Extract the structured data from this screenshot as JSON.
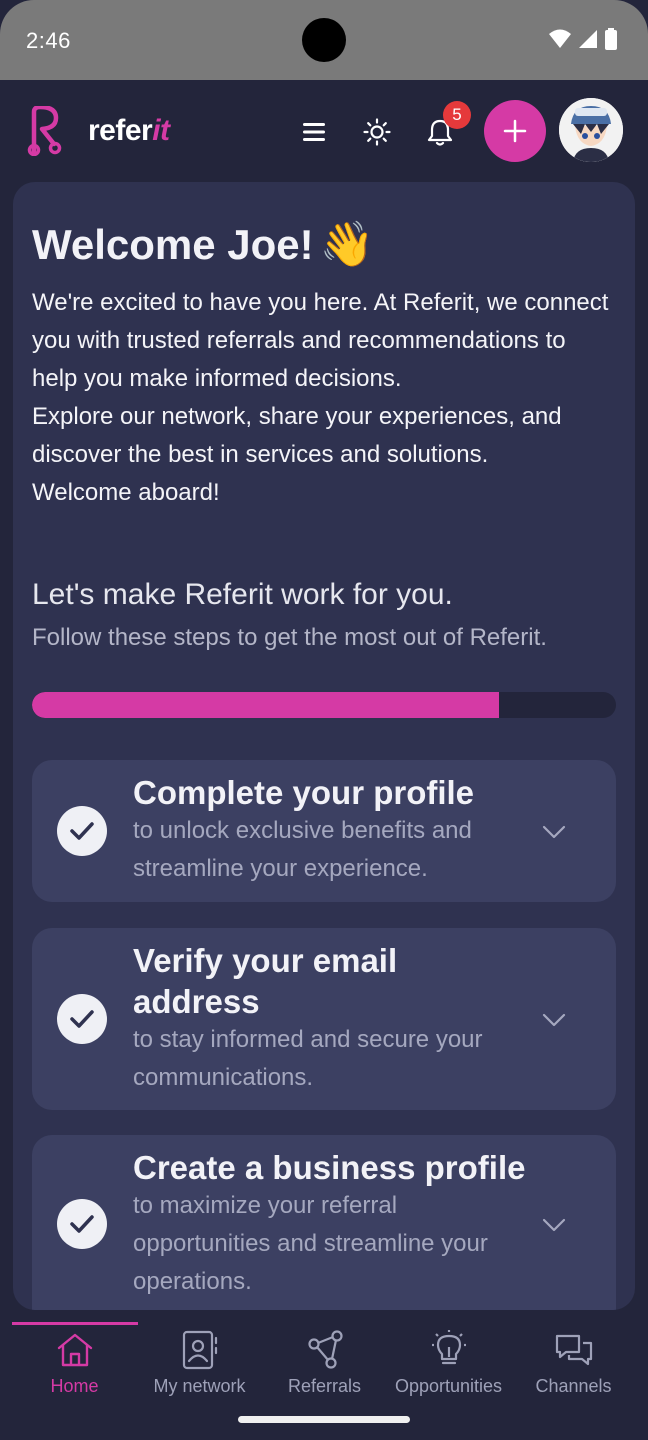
{
  "status": {
    "time": "2:46"
  },
  "app": {
    "logo_text_main": "refer",
    "logo_text_accent": "it",
    "notification_count": "5"
  },
  "welcome": {
    "title": "Welcome Joe!",
    "emoji": "👋",
    "paragraph_1": "We're excited to have you here. At Referit, we connect you with trusted referrals and recommendations to help you make informed decisions.",
    "paragraph_2": "Explore our network, share your experiences, and discover the best in services and solutions.",
    "paragraph_3": "Welcome aboard!"
  },
  "onboarding": {
    "title": "Let's make Referit work for you.",
    "subtitle": "Follow these steps to get the most out of Referit.",
    "progress_percent": 80,
    "steps": [
      {
        "title": "Complete your profile",
        "description": "to unlock exclusive benefits and streamline your experience.",
        "completed": true
      },
      {
        "title": "Verify your email address",
        "description": "to stay informed and secure your communications.",
        "completed": true
      },
      {
        "title": "Create a business profile",
        "description": "to maximize your referral opportunities and streamline your operations.",
        "completed": true
      }
    ]
  },
  "nav": {
    "items": [
      {
        "label": "Home",
        "icon": "home-icon",
        "active": true
      },
      {
        "label": "My network",
        "icon": "contacts-icon",
        "active": false
      },
      {
        "label": "Referrals",
        "icon": "share-nodes-icon",
        "active": false
      },
      {
        "label": "Opportunities",
        "icon": "lightbulb-icon",
        "active": false
      },
      {
        "label": "Channels",
        "icon": "chat-bubbles-icon",
        "active": false
      }
    ]
  },
  "colors": {
    "accent": "#d53aa5",
    "background": "#23253b",
    "card": "#2f3250",
    "step_card": "#3c4062",
    "badge": "#e5393b"
  }
}
